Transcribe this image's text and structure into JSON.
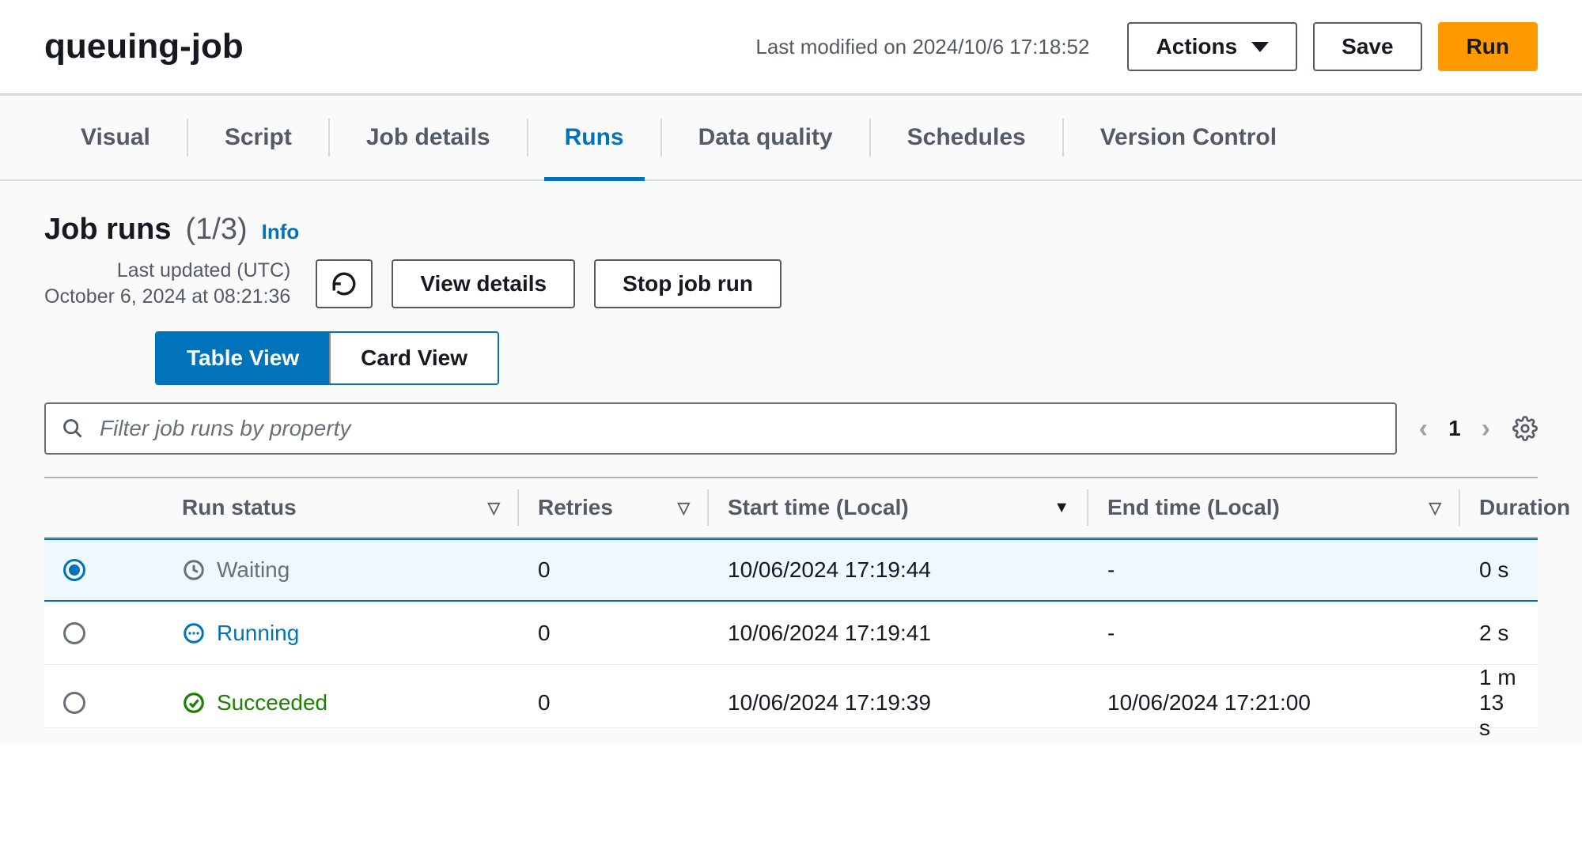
{
  "header": {
    "title": "queuing-job",
    "last_modified": "Last modified on 2024/10/6 17:18:52",
    "actions_label": "Actions",
    "save_label": "Save",
    "run_label": "Run"
  },
  "tabs": [
    {
      "id": "visual",
      "label": "Visual",
      "active": false
    },
    {
      "id": "script",
      "label": "Script",
      "active": false
    },
    {
      "id": "details",
      "label": "Job details",
      "active": false
    },
    {
      "id": "runs",
      "label": "Runs",
      "active": true
    },
    {
      "id": "dq",
      "label": "Data quality",
      "active": false
    },
    {
      "id": "sched",
      "label": "Schedules",
      "active": false
    },
    {
      "id": "version",
      "label": "Version Control",
      "active": false
    }
  ],
  "section": {
    "title": "Job runs",
    "count": "(1/3)",
    "info_label": "Info",
    "last_updated_label": "Last updated (UTC)",
    "last_updated_value": "October 6, 2024 at 08:21:36",
    "view_details_label": "View details",
    "stop_job_label": "Stop job run",
    "view_toggle": {
      "table": "Table View",
      "card": "Card View",
      "active": "table"
    }
  },
  "filter": {
    "placeholder": "Filter job runs by property",
    "page": "1"
  },
  "columns": {
    "run_status": "Run status",
    "retries": "Retries",
    "start_time": "Start time (Local)",
    "end_time": "End time (Local)",
    "duration": "Duration"
  },
  "rows": [
    {
      "selected": true,
      "status": "Waiting",
      "status_kind": "waiting",
      "retries": "0",
      "start": "10/06/2024 17:19:44",
      "end": "-",
      "duration": "0 s"
    },
    {
      "selected": false,
      "status": "Running",
      "status_kind": "running",
      "retries": "0",
      "start": "10/06/2024 17:19:41",
      "end": "-",
      "duration": "2 s"
    },
    {
      "selected": false,
      "status": "Succeeded",
      "status_kind": "succeeded",
      "retries": "0",
      "start": "10/06/2024 17:19:39",
      "end": "10/06/2024 17:21:00",
      "duration": "1 m 13 s"
    }
  ]
}
